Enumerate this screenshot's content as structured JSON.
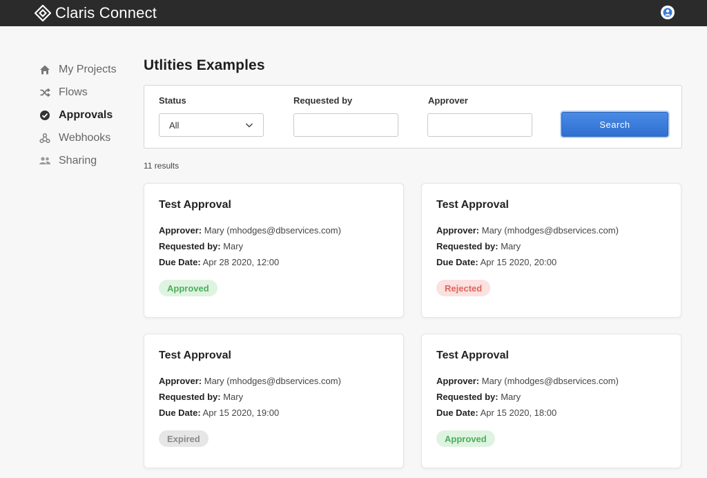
{
  "app": {
    "name": "Claris Connect"
  },
  "sidebar": {
    "items": [
      {
        "label": "My Projects",
        "icon": "home-icon",
        "active": false
      },
      {
        "label": "Flows",
        "icon": "shuffle-icon",
        "active": false
      },
      {
        "label": "Approvals",
        "icon": "check-circle-icon",
        "active": true
      },
      {
        "label": "Webhooks",
        "icon": "webhook-icon",
        "active": false
      },
      {
        "label": "Sharing",
        "icon": "people-icon",
        "active": false
      }
    ]
  },
  "page": {
    "title": "Utlities Examples"
  },
  "filters": {
    "status_label": "Status",
    "status_value": "All",
    "requested_by_label": "Requested by",
    "requested_by_value": "",
    "approver_label": "Approver",
    "approver_value": "",
    "search_label": "Search"
  },
  "results_text": "11 results",
  "field_labels": {
    "approver": "Approver:",
    "requested_by": "Requested by:",
    "due_date": "Due Date:"
  },
  "cards": [
    {
      "title": "Test Approval",
      "approver": "Mary (mhodges@dbservices.com)",
      "requested_by": "Mary",
      "due_date": "Apr 28 2020, 12:00",
      "status": "Approved"
    },
    {
      "title": "Test Approval",
      "approver": "Mary (mhodges@dbservices.com)",
      "requested_by": "Mary",
      "due_date": "Apr 15 2020, 20:00",
      "status": "Rejected"
    },
    {
      "title": "Test Approval",
      "approver": "Mary (mhodges@dbservices.com)",
      "requested_by": "Mary",
      "due_date": "Apr 15 2020, 19:00",
      "status": "Expired"
    },
    {
      "title": "Test Approval",
      "approver": "Mary (mhodges@dbservices.com)",
      "requested_by": "Mary",
      "due_date": "Apr 15 2020, 18:00",
      "status": "Approved"
    }
  ],
  "colors": {
    "topbar": "#2b2b2b",
    "accent": "#3a7bdc",
    "approved_bg": "#dff3e1",
    "approved_fg": "#4cae5a",
    "rejected_bg": "#fbe1df",
    "rejected_fg": "#e0655a",
    "expired_bg": "#e6e6e6",
    "expired_fg": "#8a8a8a"
  }
}
